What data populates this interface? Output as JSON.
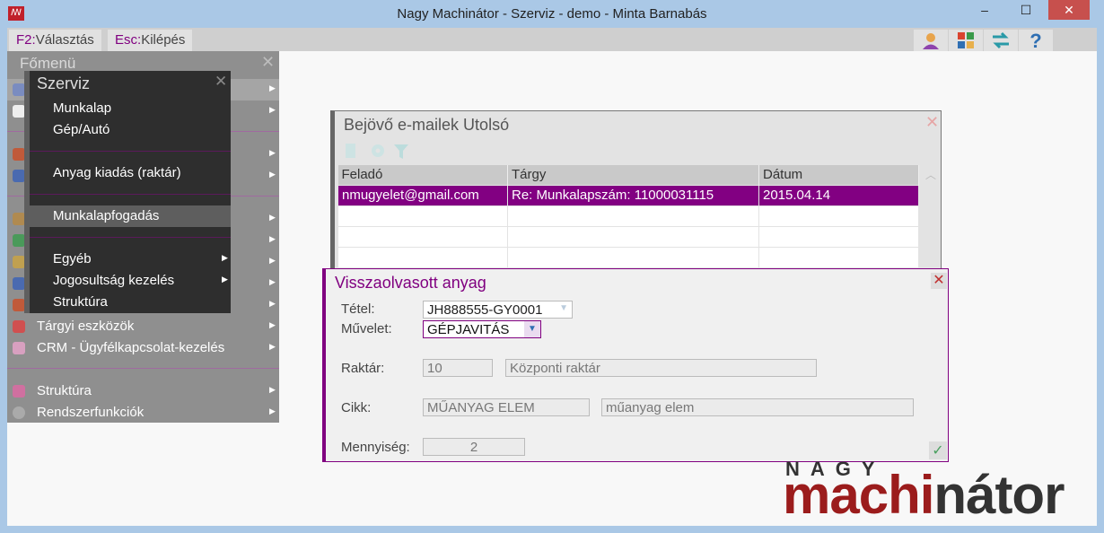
{
  "window": {
    "title": "Nagy Machinátor - Szerviz - demo - Minta Barnabás",
    "minimize": "–",
    "maximize": "☐",
    "close": "✕"
  },
  "toolbar": {
    "f2_key": "F2:",
    "f2_label": "Választás",
    "esc_key": "Esc:",
    "esc_label": "Kilépés",
    "icons": [
      "user-icon",
      "modules-icon",
      "switch-icon",
      "help-icon"
    ],
    "help": "?"
  },
  "main_menu": {
    "title": "Főmenü",
    "close": "✕",
    "items": [
      {
        "label": "Tárgyi eszközök"
      },
      {
        "label": "CRM - Ügyfélkapcsolat-kezelés"
      },
      {
        "label": "Struktúra"
      },
      {
        "label": "Rendszerfunkciók"
      }
    ]
  },
  "szerviz_menu": {
    "title": "Szerviz",
    "close": "✕",
    "items": [
      "Munkalap",
      "Gép/Autó",
      "Anyag kiadás (raktár)",
      "Munkalapfogadás",
      "Egyéb",
      "Jogosultság kezelés",
      "Struktúra"
    ]
  },
  "email_panel": {
    "title": "Bejövő e-mailek Utolsó",
    "close": "✕",
    "columns": [
      "Feladó",
      "Tárgy",
      "Dátum"
    ],
    "rows": [
      [
        "nmugyelet@gmail.com",
        "Re: Munkalapszám: 11000031115",
        "2015.04.14"
      ]
    ]
  },
  "dialog": {
    "title": "Visszaolvasott anyag",
    "close": "✕",
    "tetel_label": "Tétel:",
    "tetel_value": "JH888555-GY0001",
    "muvelet_label": "Művelet:",
    "muvelet_value": "GÉPJAVITÁS",
    "raktar_label": "Raktár:",
    "raktar_code": "10",
    "raktar_name": "Központi raktár",
    "cikk_label": "Cikk:",
    "cikk_code": "MŰANYAG ELEM",
    "cikk_name": "műanyag elem",
    "mennyiseg_label": "Mennyiség:",
    "mennyiseg_value": "2",
    "ok": "✓"
  },
  "logo": {
    "top": "NAGY",
    "red": "machi",
    "dark": "nátor"
  },
  "colors": {
    "accent": "#800080",
    "logo_red": "#9b1c1c"
  }
}
